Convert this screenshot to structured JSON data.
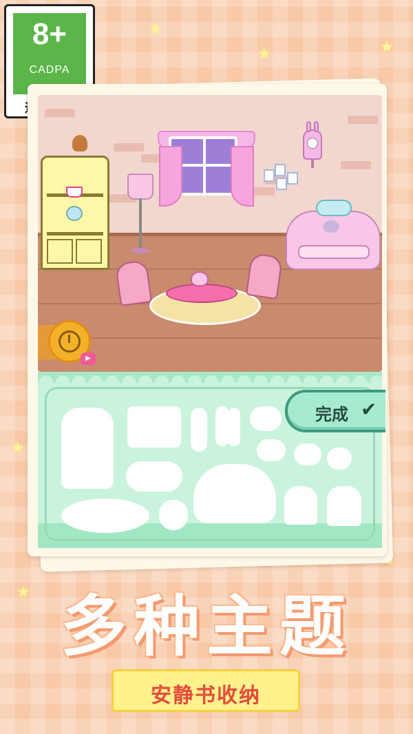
{
  "age_rating": {
    "age": "8+",
    "org": "CADPA",
    "tip": "适龄提示"
  },
  "done_button": {
    "label": "完成",
    "check_icon": "checkmark-icon"
  },
  "title": "多种主题",
  "subtitle": "安静书收纳",
  "icons": {
    "video_clock": "clock-video-icon",
    "star": "star-icon"
  },
  "colors": {
    "badge_green": "#5bb548",
    "tray_green": "#c9f3dc",
    "background_peach": "#f8c9a8",
    "ribbon_yellow": "#fff28c",
    "subtitle_red": "#e34b3d"
  }
}
